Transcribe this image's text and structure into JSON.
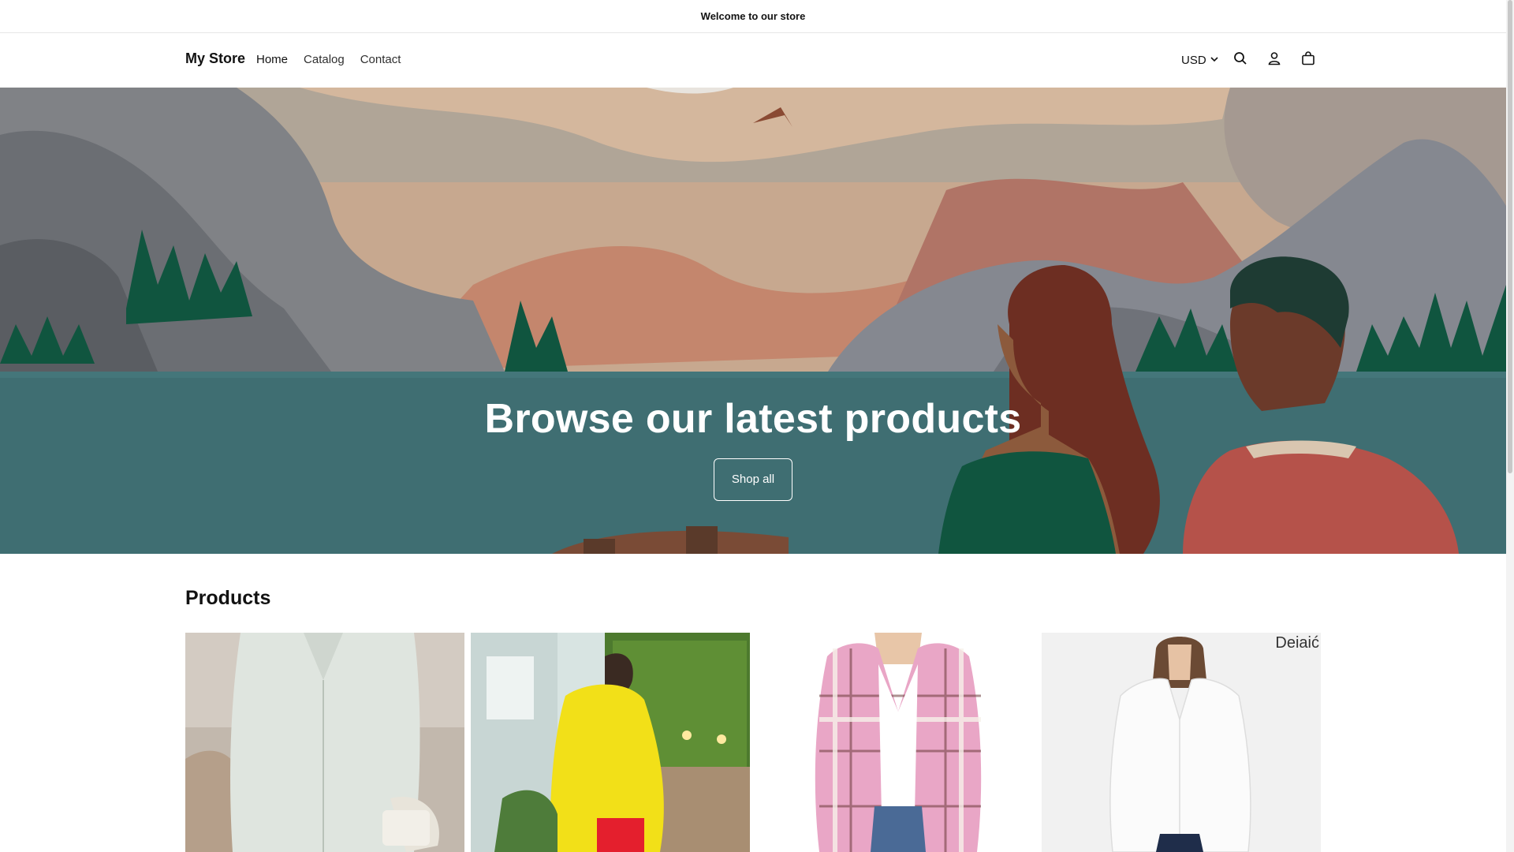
{
  "announcement": {
    "text": "Welcome to our store"
  },
  "header": {
    "logo": "My Store",
    "nav": [
      {
        "label": "Home"
      },
      {
        "label": "Catalog"
      },
      {
        "label": "Contact"
      }
    ],
    "currency": "USD",
    "icons": [
      "search-icon",
      "account-icon",
      "cart-icon",
      "chevron-down-icon"
    ]
  },
  "hero": {
    "title": "Browse our latest products",
    "button_label": "Shop all"
  },
  "products": {
    "heading": "Products",
    "items": [
      {
        "image": "striped-shirt-photo"
      },
      {
        "image": "yellow-shirt-dress-photo"
      },
      {
        "image": "plaid-shacket-photo"
      },
      {
        "image": "white-blouse-photo",
        "brand_text": "Deiaić"
      }
    ]
  },
  "colors": {
    "water": "#3f6e72",
    "tree": "#10553f",
    "text": "#121212"
  }
}
